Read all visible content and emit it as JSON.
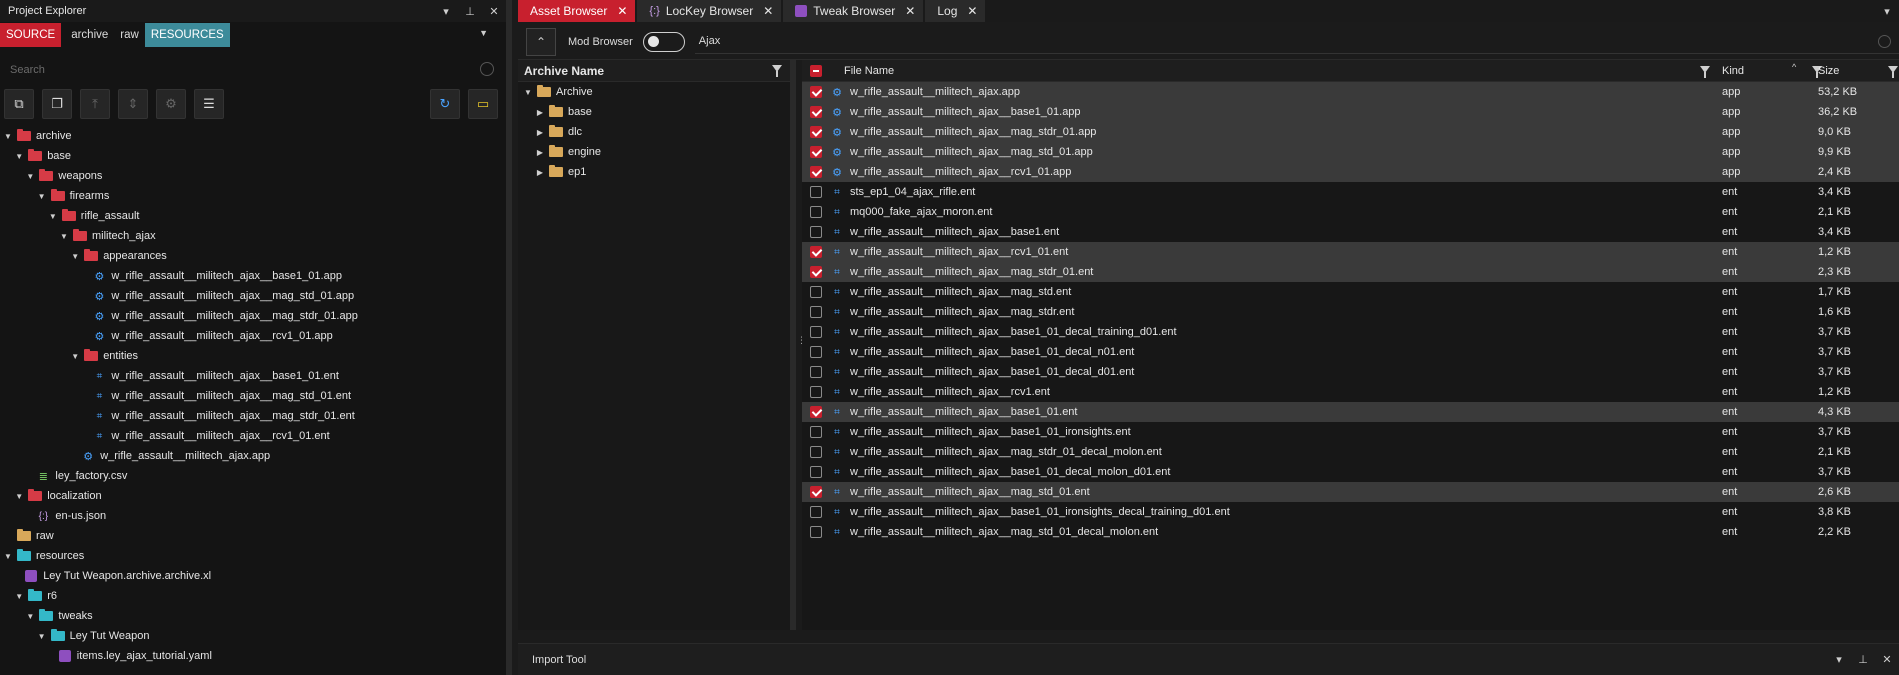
{
  "left": {
    "title": "Project Explorer",
    "source_tabs": [
      "SOURCE",
      "archive",
      "raw",
      "RESOURCES"
    ],
    "search_placeholder": "Search",
    "tree": [
      {
        "label": "archive",
        "depth": 0,
        "kind": "folder",
        "color": "red",
        "caret": "down"
      },
      {
        "label": "base",
        "depth": 1,
        "kind": "folder",
        "color": "red",
        "caret": "down"
      },
      {
        "label": "weapons",
        "depth": 2,
        "kind": "folder",
        "color": "red",
        "caret": "down"
      },
      {
        "label": "firearms",
        "depth": 3,
        "kind": "folder",
        "color": "red",
        "caret": "down"
      },
      {
        "label": "rifle_assault",
        "depth": 4,
        "kind": "folder",
        "color": "red",
        "caret": "down"
      },
      {
        "label": "militech_ajax",
        "depth": 5,
        "kind": "folder",
        "color": "red",
        "caret": "down"
      },
      {
        "label": "appearances",
        "depth": 6,
        "kind": "folder",
        "color": "red",
        "caret": "down"
      },
      {
        "label": "w_rifle_assault__militech_ajax__base1_01.app",
        "depth": 7,
        "kind": "app"
      },
      {
        "label": "w_rifle_assault__militech_ajax__mag_std_01.app",
        "depth": 7,
        "kind": "app"
      },
      {
        "label": "w_rifle_assault__militech_ajax__mag_stdr_01.app",
        "depth": 7,
        "kind": "app"
      },
      {
        "label": "w_rifle_assault__militech_ajax__rcv1_01.app",
        "depth": 7,
        "kind": "app"
      },
      {
        "label": "entities",
        "depth": 6,
        "kind": "folder",
        "color": "red",
        "caret": "down"
      },
      {
        "label": "w_rifle_assault__militech_ajax__base1_01.ent",
        "depth": 7,
        "kind": "ent"
      },
      {
        "label": "w_rifle_assault__militech_ajax__mag_std_01.ent",
        "depth": 7,
        "kind": "ent"
      },
      {
        "label": "w_rifle_assault__militech_ajax__mag_stdr_01.ent",
        "depth": 7,
        "kind": "ent"
      },
      {
        "label": "w_rifle_assault__militech_ajax__rcv1_01.ent",
        "depth": 7,
        "kind": "ent"
      },
      {
        "label": "w_rifle_assault__militech_ajax.app",
        "depth": 6,
        "kind": "app"
      },
      {
        "label": "ley_factory.csv",
        "depth": 2,
        "kind": "csv"
      },
      {
        "label": "localization",
        "depth": 1,
        "kind": "folder",
        "color": "red",
        "caret": "down"
      },
      {
        "label": "en-us.json",
        "depth": 2,
        "kind": "json"
      },
      {
        "label": "raw",
        "depth": 0,
        "kind": "folder",
        "color": "tan",
        "caret": "none"
      },
      {
        "label": "resources",
        "depth": 0,
        "kind": "folder",
        "color": "cyan",
        "caret": "down"
      },
      {
        "label": "Ley Tut Weapon.archive.archive.xl",
        "depth": 1,
        "kind": "xl"
      },
      {
        "label": "r6",
        "depth": 1,
        "kind": "folder",
        "color": "cyan",
        "caret": "down"
      },
      {
        "label": "tweaks",
        "depth": 2,
        "kind": "folder",
        "color": "cyan",
        "caret": "down"
      },
      {
        "label": "Ley Tut Weapon",
        "depth": 3,
        "kind": "folder",
        "color": "cyan",
        "caret": "down"
      },
      {
        "label": "items.ley_ajax_tutorial.yaml",
        "depth": 4,
        "kind": "xl"
      }
    ]
  },
  "tabs": [
    {
      "label": "Asset Browser",
      "active": true
    },
    {
      "label": "LocKey Browser",
      "active": false,
      "icon": "{:}"
    },
    {
      "label": "Tweak Browser",
      "active": false,
      "icon": "tweak"
    },
    {
      "label": "Log",
      "active": false
    }
  ],
  "mod_browser_label": "Mod Browser",
  "search_value": "Ajax",
  "archive_pane": {
    "header": "Archive Name",
    "root": "Archive",
    "children": [
      "base",
      "dlc",
      "engine",
      "ep1"
    ]
  },
  "columns": {
    "name": "File Name",
    "kind": "Kind",
    "size": "Size"
  },
  "files": [
    {
      "name": "w_rifle_assault__militech_ajax.app",
      "kind": "app",
      "size": "53,2 KB",
      "checked": true
    },
    {
      "name": "w_rifle_assault__militech_ajax__base1_01.app",
      "kind": "app",
      "size": "36,2 KB",
      "checked": true
    },
    {
      "name": "w_rifle_assault__militech_ajax__mag_stdr_01.app",
      "kind": "app",
      "size": "9,0 KB",
      "checked": true
    },
    {
      "name": "w_rifle_assault__militech_ajax__mag_std_01.app",
      "kind": "app",
      "size": "9,9 KB",
      "checked": true
    },
    {
      "name": "w_rifle_assault__militech_ajax__rcv1_01.app",
      "kind": "app",
      "size": "2,4 KB",
      "checked": true
    },
    {
      "name": "sts_ep1_04_ajax_rifle.ent",
      "kind": "ent",
      "size": "3,4 KB",
      "checked": false
    },
    {
      "name": "mq000_fake_ajax_moron.ent",
      "kind": "ent",
      "size": "2,1 KB",
      "checked": false
    },
    {
      "name": "w_rifle_assault__militech_ajax__base1.ent",
      "kind": "ent",
      "size": "3,4 KB",
      "checked": false
    },
    {
      "name": "w_rifle_assault__militech_ajax__rcv1_01.ent",
      "kind": "ent",
      "size": "1,2 KB",
      "checked": true
    },
    {
      "name": "w_rifle_assault__militech_ajax__mag_stdr_01.ent",
      "kind": "ent",
      "size": "2,3 KB",
      "checked": true
    },
    {
      "name": "w_rifle_assault__militech_ajax__mag_std.ent",
      "kind": "ent",
      "size": "1,7 KB",
      "checked": false
    },
    {
      "name": "w_rifle_assault__militech_ajax__mag_stdr.ent",
      "kind": "ent",
      "size": "1,6 KB",
      "checked": false
    },
    {
      "name": "w_rifle_assault__militech_ajax__base1_01_decal_training_d01.ent",
      "kind": "ent",
      "size": "3,7 KB",
      "checked": false
    },
    {
      "name": "w_rifle_assault__militech_ajax__base1_01_decal_n01.ent",
      "kind": "ent",
      "size": "3,7 KB",
      "checked": false
    },
    {
      "name": "w_rifle_assault__militech_ajax__base1_01_decal_d01.ent",
      "kind": "ent",
      "size": "3,7 KB",
      "checked": false
    },
    {
      "name": "w_rifle_assault__militech_ajax__rcv1.ent",
      "kind": "ent",
      "size": "1,2 KB",
      "checked": false
    },
    {
      "name": "w_rifle_assault__militech_ajax__base1_01.ent",
      "kind": "ent",
      "size": "4,3 KB",
      "checked": true
    },
    {
      "name": "w_rifle_assault__militech_ajax__base1_01_ironsights.ent",
      "kind": "ent",
      "size": "3,7 KB",
      "checked": false
    },
    {
      "name": "w_rifle_assault__militech_ajax__mag_stdr_01_decal_molon.ent",
      "kind": "ent",
      "size": "2,1 KB",
      "checked": false
    },
    {
      "name": "w_rifle_assault__militech_ajax__base1_01_decal_molon_d01.ent",
      "kind": "ent",
      "size": "3,7 KB",
      "checked": false
    },
    {
      "name": "w_rifle_assault__militech_ajax__mag_std_01.ent",
      "kind": "ent",
      "size": "2,6 KB",
      "checked": true
    },
    {
      "name": "w_rifle_assault__militech_ajax__base1_01_ironsights_decal_training_d01.ent",
      "kind": "ent",
      "size": "3,8 KB",
      "checked": false
    },
    {
      "name": "w_rifle_assault__militech_ajax__mag_std_01_decal_molon.ent",
      "kind": "ent",
      "size": "2,2 KB",
      "checked": false
    }
  ],
  "bottom_panel": "Import Tool",
  "colors": {
    "accent": "#c8202e",
    "resources_tab": "#3d8b9a",
    "icon_blue": "#4aa3ff"
  }
}
